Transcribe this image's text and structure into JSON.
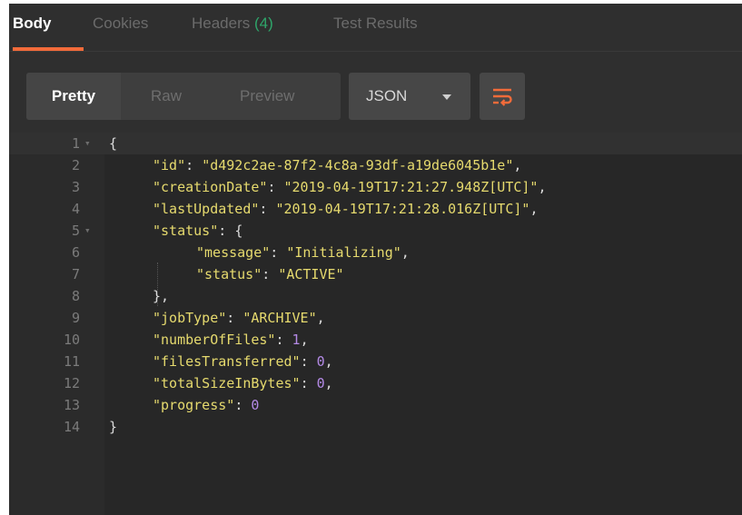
{
  "tabs": [
    {
      "label": "Body",
      "active": true
    },
    {
      "label": "Cookies",
      "active": false
    },
    {
      "label": "Headers",
      "count": "(4)",
      "active": false
    },
    {
      "label": "Test Results",
      "active": false
    }
  ],
  "view_modes": [
    {
      "label": "Pretty",
      "active": true
    },
    {
      "label": "Raw",
      "active": false
    },
    {
      "label": "Preview",
      "active": false
    }
  ],
  "format": {
    "label": "JSON"
  },
  "icons": {
    "dropdown": "caret-down-icon",
    "wrap": "wrap-lines-icon",
    "fold": "fold-arrow-icon"
  },
  "colors": {
    "accent": "#f26b3a",
    "count": "#2fa56a",
    "key": "#e6da6e",
    "string": "#e6da6e",
    "number": "#b48ae6"
  },
  "editor": {
    "fold_marker": "▾",
    "lines": [
      {
        "num": "1",
        "fold": true,
        "indent": 0,
        "open": "{"
      },
      {
        "num": "2",
        "indent": 1,
        "key": "\"id\"",
        "value": "\"d492c2ae-87f2-4c8a-93df-a19de6045b1e\"",
        "vtype": "s",
        "tail": ","
      },
      {
        "num": "3",
        "indent": 1,
        "key": "\"creationDate\"",
        "value": "\"2019-04-19T17:21:27.948Z[UTC]\"",
        "vtype": "s",
        "tail": ","
      },
      {
        "num": "4",
        "indent": 1,
        "key": "\"lastUpdated\"",
        "value": "\"2019-04-19T17:21:28.016Z[UTC]\"",
        "vtype": "s",
        "tail": ","
      },
      {
        "num": "5",
        "fold": true,
        "indent": 1,
        "key": "\"status\"",
        "value": "{",
        "vtype": "p",
        "tail": ""
      },
      {
        "num": "6",
        "indent": 2,
        "key": "\"message\"",
        "value": "\"Initializing\"",
        "vtype": "s",
        "tail": ","
      },
      {
        "num": "7",
        "indent": 2,
        "key": "\"status\"",
        "value": "\"ACTIVE\"",
        "vtype": "s",
        "tail": ""
      },
      {
        "num": "8",
        "indent": 1,
        "open": "},"
      },
      {
        "num": "9",
        "indent": 1,
        "key": "\"jobType\"",
        "value": "\"ARCHIVE\"",
        "vtype": "s",
        "tail": ","
      },
      {
        "num": "10",
        "indent": 1,
        "key": "\"numberOfFiles\"",
        "value": "1",
        "vtype": "n",
        "tail": ","
      },
      {
        "num": "11",
        "indent": 1,
        "key": "\"filesTransferred\"",
        "value": "0",
        "vtype": "n",
        "tail": ","
      },
      {
        "num": "12",
        "indent": 1,
        "key": "\"totalSizeInBytes\"",
        "value": "0",
        "vtype": "n",
        "tail": ","
      },
      {
        "num": "13",
        "indent": 1,
        "key": "\"progress\"",
        "value": "0",
        "vtype": "n",
        "tail": ""
      },
      {
        "num": "14",
        "indent": 0,
        "open": "}"
      }
    ]
  }
}
